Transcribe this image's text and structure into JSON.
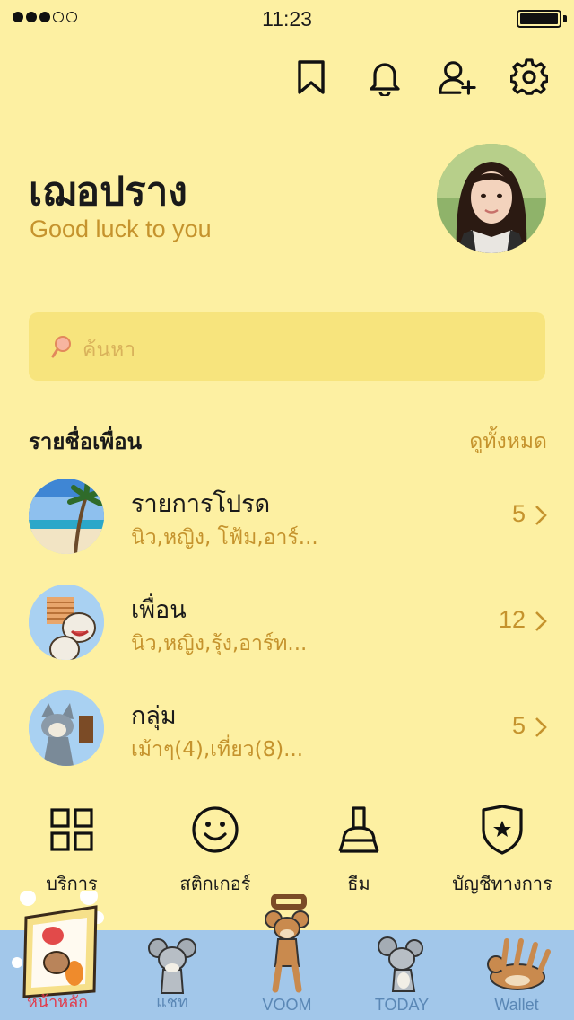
{
  "status_bar": {
    "time": "11:23",
    "signal_bars_filled": 3,
    "signal_bars_total": 5,
    "battery_level": 1.0
  },
  "toolbar": {
    "icons": [
      "bookmark-icon",
      "bell-icon",
      "add-friend-icon",
      "gear-icon"
    ]
  },
  "profile": {
    "name": "เฌอปราง",
    "status_message": "Good luck to you"
  },
  "search": {
    "placeholder": "ค้นหา"
  },
  "friends_section": {
    "title": "รายชื่อเพื่อน",
    "see_all": "ดูทั้งหมด",
    "rows": [
      {
        "title": "รายการโปรด",
        "subtitle": "นิว,หญิง, โฟ้ม,อาร์...",
        "count": "5"
      },
      {
        "title": "เพื่อน",
        "subtitle": "นิว,หญิง,รุ้ง,อาร์ท...",
        "count": "12"
      },
      {
        "title": "กลุ่ม",
        "subtitle": "เม้าๆ(4),เที่ยว(8)...",
        "count": "5"
      }
    ]
  },
  "services": [
    {
      "label": "บริการ",
      "icon": "grid-icon"
    },
    {
      "label": "สติกเกอร์",
      "icon": "smiley-icon"
    },
    {
      "label": "ธีม",
      "icon": "brush-icon"
    },
    {
      "label": "บัญชีทางการ",
      "icon": "shield-star-icon"
    }
  ],
  "tabs": [
    {
      "label": "หน้าหลัก",
      "active": true
    },
    {
      "label": "แชท",
      "active": false
    },
    {
      "label": "VOOM",
      "active": false
    },
    {
      "label": "TODAY",
      "active": false
    },
    {
      "label": "Wallet",
      "active": false
    }
  ],
  "colors": {
    "background": "#fdf0a2",
    "search_bg": "#f7e47d",
    "accent_text": "#c5932d",
    "tabbar_bg": "#a2c7ea",
    "active_tab": "#e23a4a"
  }
}
